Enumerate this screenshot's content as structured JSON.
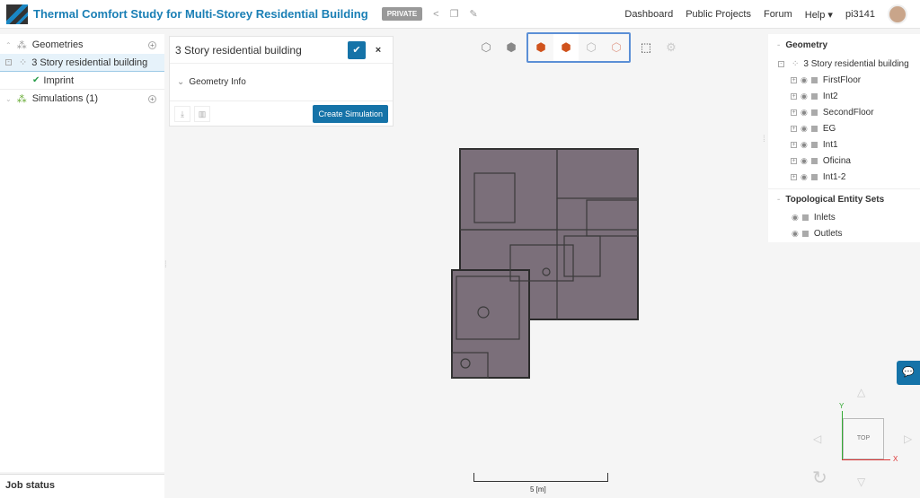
{
  "header": {
    "title": "Thermal Comfort Study for Multi-Storey Residential Building",
    "privacy_badge": "PRIVATE",
    "nav": [
      "Dashboard",
      "Public Projects",
      "Forum",
      "Help ▾",
      "pi3141"
    ]
  },
  "left_tree": {
    "geometries": "Geometries",
    "geometry_item": "3 Story residential building",
    "imprint": "Imprint",
    "simulations": "Simulations (1)"
  },
  "job_status": "Job status",
  "geometry_panel": {
    "name": "3 Story residential building",
    "section": "Geometry Info",
    "create_button": "Create Simulation"
  },
  "right_tree": {
    "header": "Geometry",
    "root": "3 Story residential building",
    "items": [
      "FirstFloor",
      "Int2",
      "SecondFloor",
      "EG",
      "Int1",
      "Oficina",
      "Int1-2"
    ],
    "sets_header": "Topological Entity Sets",
    "sets": [
      "Inlets",
      "Outlets"
    ]
  },
  "viewport": {
    "scale_label": "5 [m]",
    "cube_label": "TOP",
    "axis_x": "X",
    "axis_y": "Y"
  },
  "colors": {
    "accent": "#1573a8",
    "building": "#7b6f7a"
  }
}
